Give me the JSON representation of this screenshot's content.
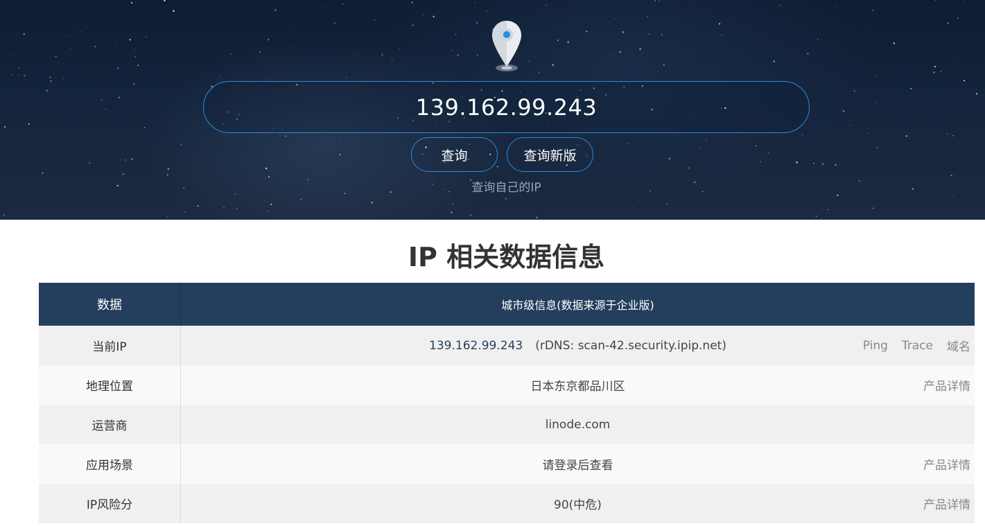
{
  "search": {
    "value": "139.162.99.243",
    "query_button": "查询",
    "new_version_button": "查询新版",
    "self_ip_link": "查询自己的IP"
  },
  "section": {
    "title": "IP 相关数据信息"
  },
  "table": {
    "header": {
      "key": "数据",
      "value": "城市级信息(数据来源于企业版)"
    },
    "rows": [
      {
        "key": "当前IP",
        "ip": "139.162.99.243",
        "rdns": "(rDNS: scan-42.security.ipip.net)",
        "actions": [
          "Ping",
          "Trace",
          "域名"
        ]
      },
      {
        "key": "地理位置",
        "value": "日本东京都品川区",
        "action": "产品详情"
      },
      {
        "key": "运营商",
        "value": "linode.com"
      },
      {
        "key": "应用场景",
        "value": "请登录后查看",
        "action": "产品详情"
      },
      {
        "key": "IP风险分",
        "value": "90(中危)",
        "action": "产品详情"
      }
    ]
  },
  "icons": {
    "hero_icon": "location-pin-icon"
  },
  "colors": {
    "accent": "#2b8be0",
    "table_header": "#243f5d",
    "hero_background": "#13243c"
  }
}
